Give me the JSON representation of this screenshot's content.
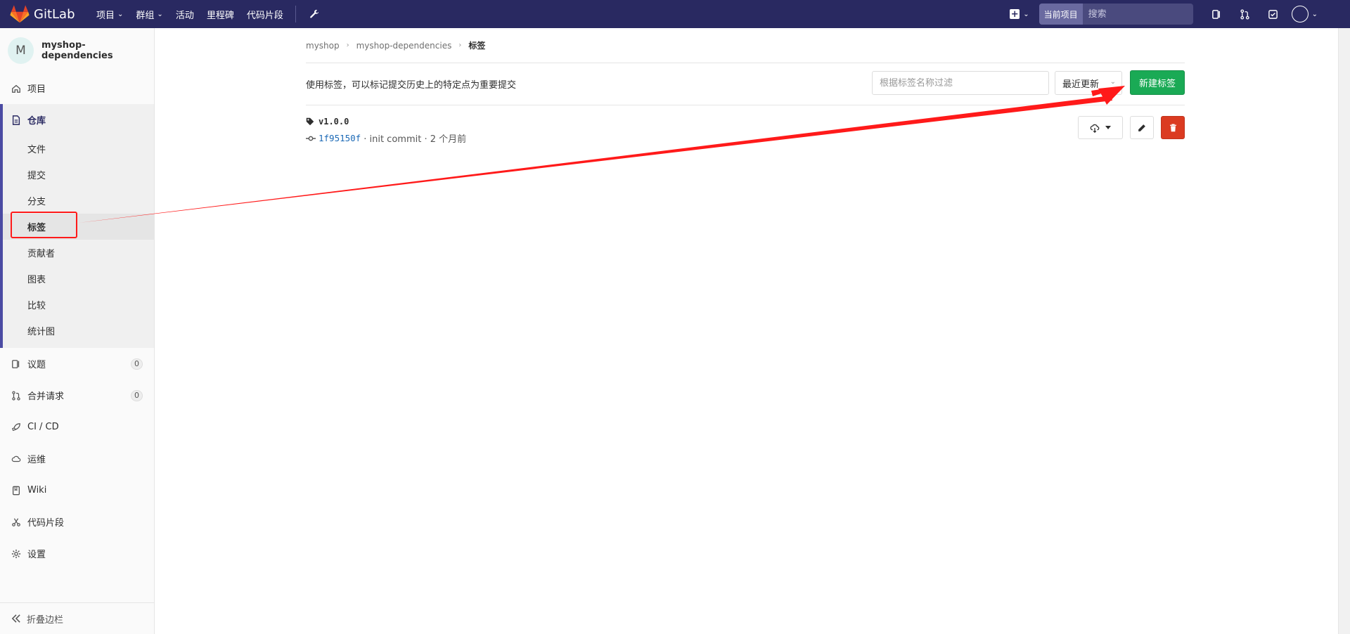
{
  "navbar": {
    "brand": "GitLab",
    "items": [
      {
        "label": "项目",
        "has_dropdown": true
      },
      {
        "label": "群组",
        "has_dropdown": true
      },
      {
        "label": "活动",
        "has_dropdown": false
      },
      {
        "label": "里程碑",
        "has_dropdown": false
      },
      {
        "label": "代码片段",
        "has_dropdown": false
      }
    ],
    "search_scope": "当前项目",
    "search_placeholder": "搜索",
    "colors": {
      "bg": "#292961"
    }
  },
  "sidebar": {
    "project_initial": "M",
    "project_name": "myshop-dependencies",
    "items_top": [
      {
        "label": "项目",
        "icon": "home-icon"
      }
    ],
    "repo": {
      "label": "仓库",
      "icon": "document-icon",
      "sub_items": [
        {
          "label": "文件",
          "active": false
        },
        {
          "label": "提交",
          "active": false
        },
        {
          "label": "分支",
          "active": false
        },
        {
          "label": "标签",
          "active": true
        },
        {
          "label": "贡献者",
          "active": false
        },
        {
          "label": "图表",
          "active": false
        },
        {
          "label": "比较",
          "active": false
        },
        {
          "label": "统计图",
          "active": false
        }
      ]
    },
    "items_bottom": [
      {
        "label": "议题",
        "icon": "issues-icon",
        "count": "0"
      },
      {
        "label": "合并请求",
        "icon": "merge-request-icon",
        "count": "0"
      },
      {
        "label": "CI / CD",
        "icon": "rocket-icon"
      },
      {
        "label": "运维",
        "icon": "cloud-icon"
      },
      {
        "label": "Wiki",
        "icon": "book-icon"
      },
      {
        "label": "代码片段",
        "icon": "scissors-icon"
      },
      {
        "label": "设置",
        "icon": "gear-icon"
      }
    ],
    "collapse_label": "折叠边栏"
  },
  "breadcrumb": {
    "items": [
      "myshop",
      "myshop-dependencies",
      "标签"
    ]
  },
  "top_area": {
    "description": "使用标签，可以标记提交历史上的特定点为重要提交",
    "filter_placeholder": "根据标签名称过滤",
    "sort_label": "最近更新",
    "new_tag_label": "新建标签",
    "colors": {
      "new_tag": "#1aaa55",
      "delete": "#db3b21"
    }
  },
  "tags": [
    {
      "name": "v1.0.0",
      "commit_sha": "1f95150f",
      "commit_message": "· init commit · 2 个月前"
    }
  ],
  "annotation": {
    "color": "#ff1a1a"
  }
}
